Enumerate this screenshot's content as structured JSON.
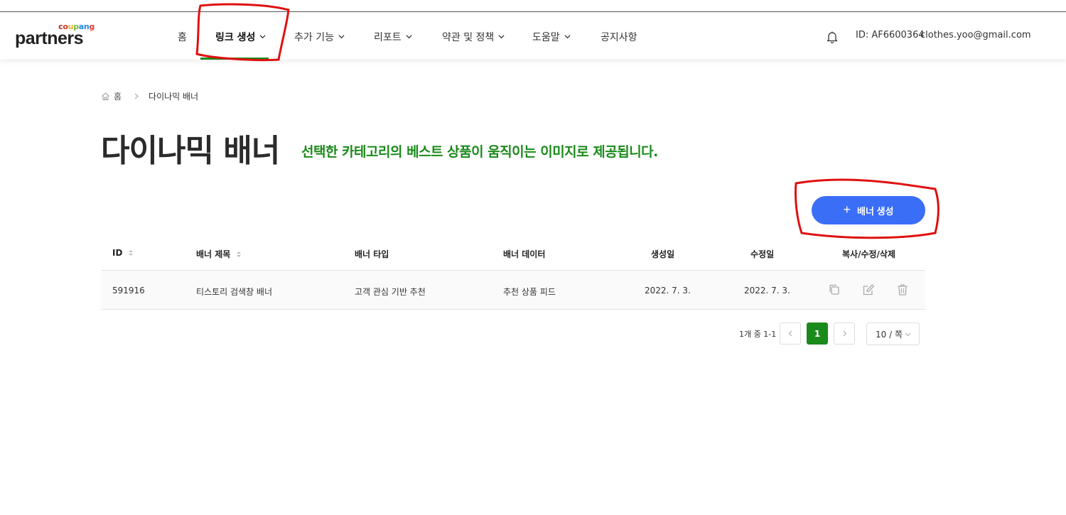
{
  "header": {
    "logo_small": "coupang",
    "logo_main": "partners",
    "nav": [
      {
        "label": "홈",
        "has_dropdown": false,
        "active": false
      },
      {
        "label": "링크 생성",
        "has_dropdown": true,
        "active": true
      },
      {
        "label": "추가 기능",
        "has_dropdown": true,
        "active": false
      },
      {
        "label": "리포트",
        "has_dropdown": true,
        "active": false
      },
      {
        "label": "약관 및 정책",
        "has_dropdown": true,
        "active": false
      },
      {
        "label": "도움말",
        "has_dropdown": true,
        "active": false
      },
      {
        "label": "공지사항",
        "has_dropdown": false,
        "active": false
      }
    ],
    "user_id": "ID: AF6600364",
    "email": "clothes.yoo@gmail.com"
  },
  "breadcrumb": {
    "home": "홈",
    "current": "다이나믹 배너"
  },
  "page": {
    "title": "다이나믹 배너",
    "description": "선택한 카테고리의 베스트 상품이 움직이는 이미지로 제공됩니다.",
    "create_button": "배너 생성"
  },
  "table": {
    "headers": {
      "id": "ID",
      "title": "배너 제목",
      "type": "배너 타입",
      "data": "배너 데이터",
      "created": "생성일",
      "modified": "수정일",
      "actions": "복사/수정/삭제"
    },
    "rows": [
      {
        "id": "591916",
        "title": "티스토리 검색창 배너",
        "type": "고객 관심 기반 추천",
        "data": "추천 상품 피드",
        "created": "2022. 7. 3.",
        "modified": "2022. 7. 3."
      }
    ]
  },
  "pagination": {
    "summary": "1개 중 1-1",
    "current_page": "1",
    "page_size": "10 / 쪽"
  },
  "colors": {
    "accent_green": "#1a8a1a",
    "primary_blue": "#3a6ef7",
    "annotation_red": "#e01010"
  },
  "icons": [
    "bell-icon",
    "home-icon",
    "copy-icon",
    "edit-icon",
    "trash-icon",
    "chevron-down-icon",
    "chevron-left-icon",
    "chevron-right-icon",
    "sort-icon",
    "plus-icon"
  ]
}
